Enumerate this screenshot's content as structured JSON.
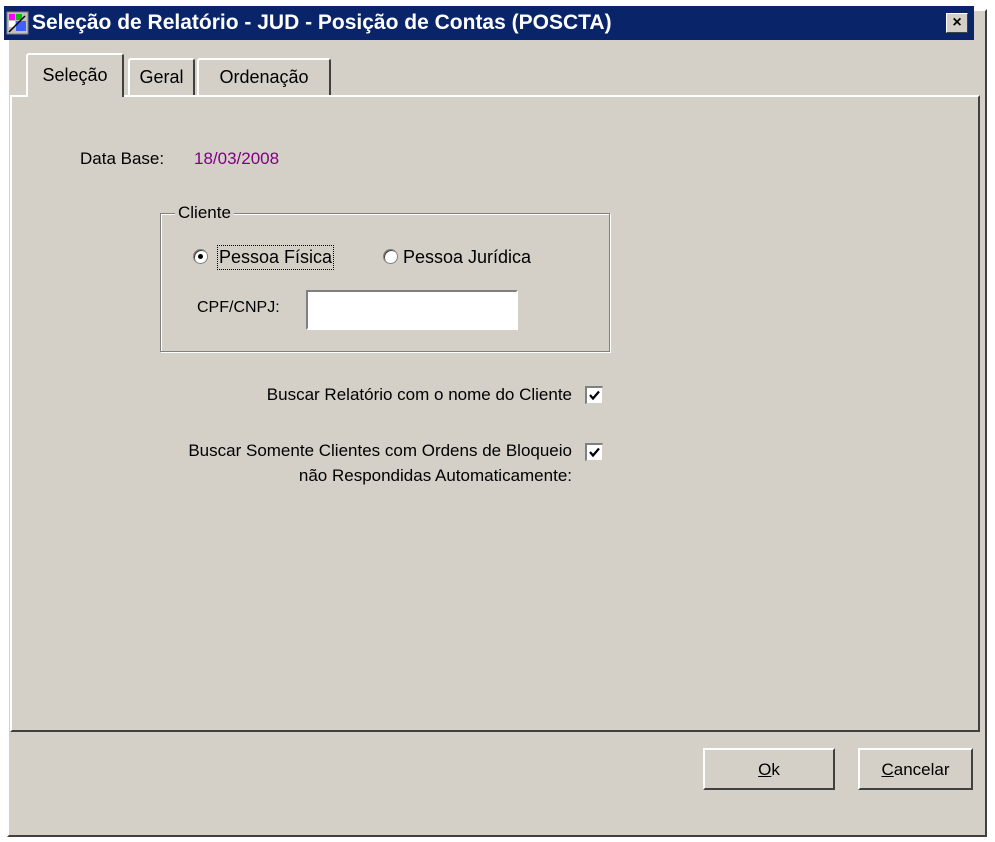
{
  "window": {
    "title": "Seleção de Relatório - JUD - Posição de Contas (POSCTA)",
    "close_glyph": "×"
  },
  "tabs": [
    {
      "label": "Seleção",
      "active": true
    },
    {
      "label": "Geral",
      "active": false
    },
    {
      "label": "Ordenação",
      "active": false
    }
  ],
  "selecao": {
    "data_base_label": "Data Base:",
    "data_base_value": "18/03/2008",
    "data_base_color": "#800080",
    "cliente_group": {
      "legend": "Cliente",
      "radio_fisica": "Pessoa Física",
      "radio_juridica": "Pessoa Jurídica",
      "selected": "Pessoa Física",
      "cpf_label": "CPF/CNPJ:",
      "cpf_value": ""
    },
    "buscar_nome_label": "Buscar Relatório com o nome do Cliente",
    "buscar_nome_checked": true,
    "buscar_bloqueio_label_line1": "Buscar Somente Clientes com Ordens de Bloqueio",
    "buscar_bloqueio_label_line2": "não Respondidas Automaticamente:",
    "buscar_bloqueio_checked": true
  },
  "buttons": {
    "ok": "Ok",
    "cancel": "Cancelar"
  },
  "colors": {
    "titlebar": "#0a246a",
    "face": "#d4d0c8"
  }
}
